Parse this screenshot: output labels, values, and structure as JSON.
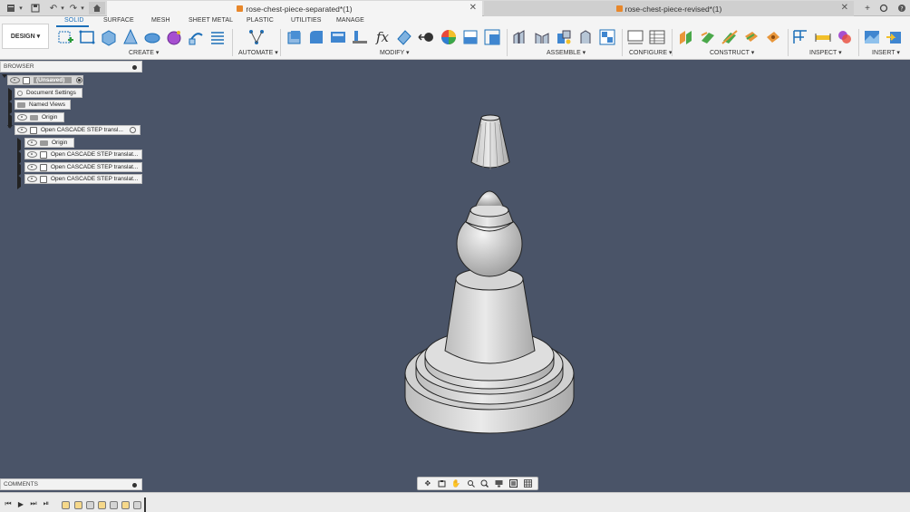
{
  "title_bar": {
    "tabs": [
      {
        "label": "rose-chest-piece-separated*(1)",
        "active": true
      },
      {
        "label": "rose-chest-piece-revised*(1)",
        "active": false
      }
    ]
  },
  "ribbon": {
    "workspace_button": "DESIGN ▾",
    "tabs": [
      "SOLID",
      "SURFACE",
      "MESH",
      "SHEET METAL",
      "PLASTIC",
      "UTILITIES",
      "MANAGE"
    ],
    "active_tab": "SOLID",
    "groups": [
      "CREATE ▾",
      "AUTOMATE ▾",
      "MODIFY ▾",
      "ASSEMBLE ▾",
      "CONFIGURE ▾",
      "CONSTRUCT ▾",
      "INSPECT ▾",
      "INSERT ▾"
    ]
  },
  "browser": {
    "title": "BROWSER",
    "items": [
      {
        "label": "(Unsaved)"
      },
      {
        "label": "Document Settings"
      },
      {
        "label": "Named Views"
      },
      {
        "label": "Origin"
      },
      {
        "label": "Open CASCADE STEP transl..."
      },
      {
        "label": "Origin"
      },
      {
        "label": "Open CASCADE STEP translat..."
      },
      {
        "label": "Open CASCADE STEP translat..."
      },
      {
        "label": "Open CASCADE STEP translat..."
      }
    ]
  },
  "comments": {
    "title": "COMMENTS"
  },
  "colors": {
    "viewport": "#4a5468",
    "accent": "#1d6fb8",
    "panel": "#f3f3f3"
  }
}
